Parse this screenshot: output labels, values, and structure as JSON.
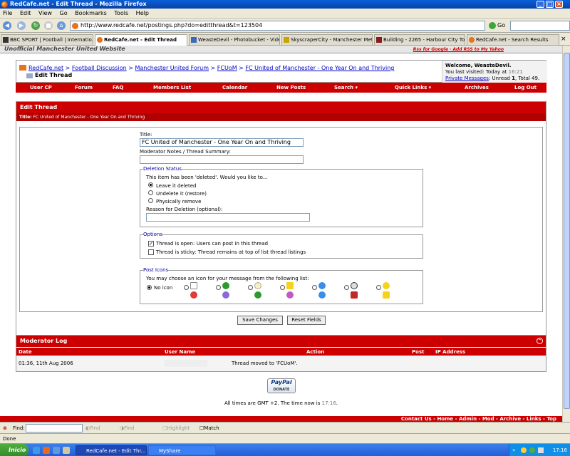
{
  "window": {
    "title": "RedCafe.net - Edit Thread - Mozilla Firefox"
  },
  "menu": [
    "File",
    "Edit",
    "View",
    "Go",
    "Bookmarks",
    "Tools",
    "Help"
  ],
  "address": {
    "url": "http://www.redcafe.net/postings.php?do=editthread&t=123504",
    "go_label": "Go"
  },
  "tabs": [
    {
      "label": "BBC SPORT | Football | Internatio..."
    },
    {
      "label": "RedCafe.net - Edit Thread",
      "active": true
    },
    {
      "label": "WeasteDevil - Photobucket - Vide..."
    },
    {
      "label": "SkyscraperCity - Manchester Metr..."
    },
    {
      "label": "Building - 2265 - Harbour City Tow..."
    },
    {
      "label": "RedCafe.net - Search Results"
    }
  ],
  "banner": {
    "title": "Unofficial Manchester United Website",
    "links": "Rss for Google  ·  Add RSS to My Yahoo"
  },
  "breadcrumb": {
    "items": [
      "RedCafe.net",
      "Football Discussion",
      "Manchester United Forum",
      "FCUoM",
      "FC United of Manchester - One Year On and Thriving"
    ],
    "separator": ">",
    "current": "Edit Thread"
  },
  "welcome": {
    "greeting": "Welcome, WeasteDevil.",
    "last_visit_label": "You last visited: Today at",
    "last_visit_time": "16:21",
    "pm_label": "Private Messages",
    "pm_unread_label": ": Unread",
    "pm_unread": "1",
    "pm_total": ", Total 49."
  },
  "navmenu": [
    "User CP",
    "Forum",
    "FAQ",
    "Members List",
    "Calendar",
    "New Posts",
    "Search ▾",
    "Quick Links ▾",
    "Archives",
    "Log Out"
  ],
  "edit_thread": {
    "header": "Edit Thread",
    "subtitle_label": "Title:",
    "subtitle_value": "FC United of Manchester - One Year On and Thriving",
    "title_label": "Title:",
    "title_value": "FC United of Manchester - One Year On and Thriving",
    "notes_label": "Moderator Notes / Thread Summary:",
    "notes_value": "",
    "deletion": {
      "legend": "Deletion Status",
      "prompt": "This item has been 'deleted'. Would you like to...",
      "options": [
        "Leave it deleted",
        "Undelete it (restore)",
        "Physically remove"
      ],
      "selected": 0,
      "reason_label": "Reason for Deletion (optional):",
      "reason_value": ""
    },
    "options": {
      "legend": "Options",
      "items": [
        {
          "label": "Thread is open: Users can post in this thread",
          "checked": true
        },
        {
          "label": "Thread is sticky: Thread remains at top of list thread listings",
          "checked": false
        }
      ]
    },
    "post_icons": {
      "legend": "Post Icons",
      "prompt": "You may choose an icon for your message from the following list:",
      "no_icon_label": "No icon",
      "icons": [
        "post-icon",
        "smile-icon",
        "arrow-icon",
        "lightbulb-icon",
        "warning-icon",
        "question-icon",
        "cool-icon",
        "happy-icon",
        "angry-icon",
        "sad-icon",
        "laugh-icon",
        "redface-icon",
        "tongue-icon",
        "wink-icon",
        "thumbs-down-icon",
        "thumbs-up-icon"
      ]
    },
    "save_label": "Save Changes",
    "reset_label": "Reset Fields"
  },
  "moderator_log": {
    "header": "Moderator Log",
    "columns": [
      "Date",
      "User Name",
      "Action",
      "Post",
      "IP Address"
    ],
    "rows": [
      {
        "date": "01:36, 11th Aug 2006",
        "user": "",
        "action": "Thread moved to 'FCUoM'.",
        "post": "",
        "ip": ""
      }
    ]
  },
  "paypal": {
    "brand": "PayPal",
    "label": "DONATE"
  },
  "timezone": {
    "prefix": "All times are GMT +2. The time now is",
    "time": "17:16",
    "suffix": "."
  },
  "footer_links": "Contact Us - Home - Admin - Mod - Archive - Links - Top",
  "findbar": {
    "label": "Find:",
    "next": "Find Next",
    "previous": "Find Previous",
    "highlight": "Highlight all",
    "match_case": "Match case"
  },
  "status": "Done",
  "taskbar": {
    "start": "Inicio",
    "tasks": [
      {
        "label": "RedCafe.net - Edit Thr...",
        "active": true
      },
      {
        "label": "MyShare",
        "active": false
      }
    ],
    "clock": "17:16"
  },
  "colors": {
    "forum_red": "#cc0000",
    "link_blue": "#0000cc",
    "xp_blue": "#245edb"
  }
}
